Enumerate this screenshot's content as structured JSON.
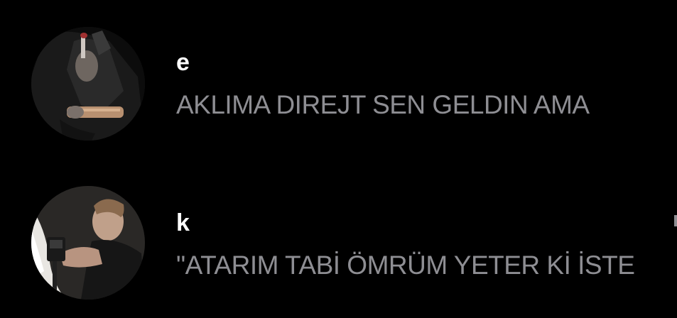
{
  "conversations": [
    {
      "avatar_icon": "user-photo-avatar",
      "name": "e",
      "preview": "AKLIMA DIREJT SEN GELDIN AMA"
    },
    {
      "avatar_icon": "user-photo-avatar",
      "name": "k",
      "preview": "\"ATARIM TABİ ÖMRÜM YETER Kİ İSTE"
    }
  ],
  "colors": {
    "background": "#000000",
    "name_text": "#ffffff",
    "preview_text": "#8e8e93"
  }
}
